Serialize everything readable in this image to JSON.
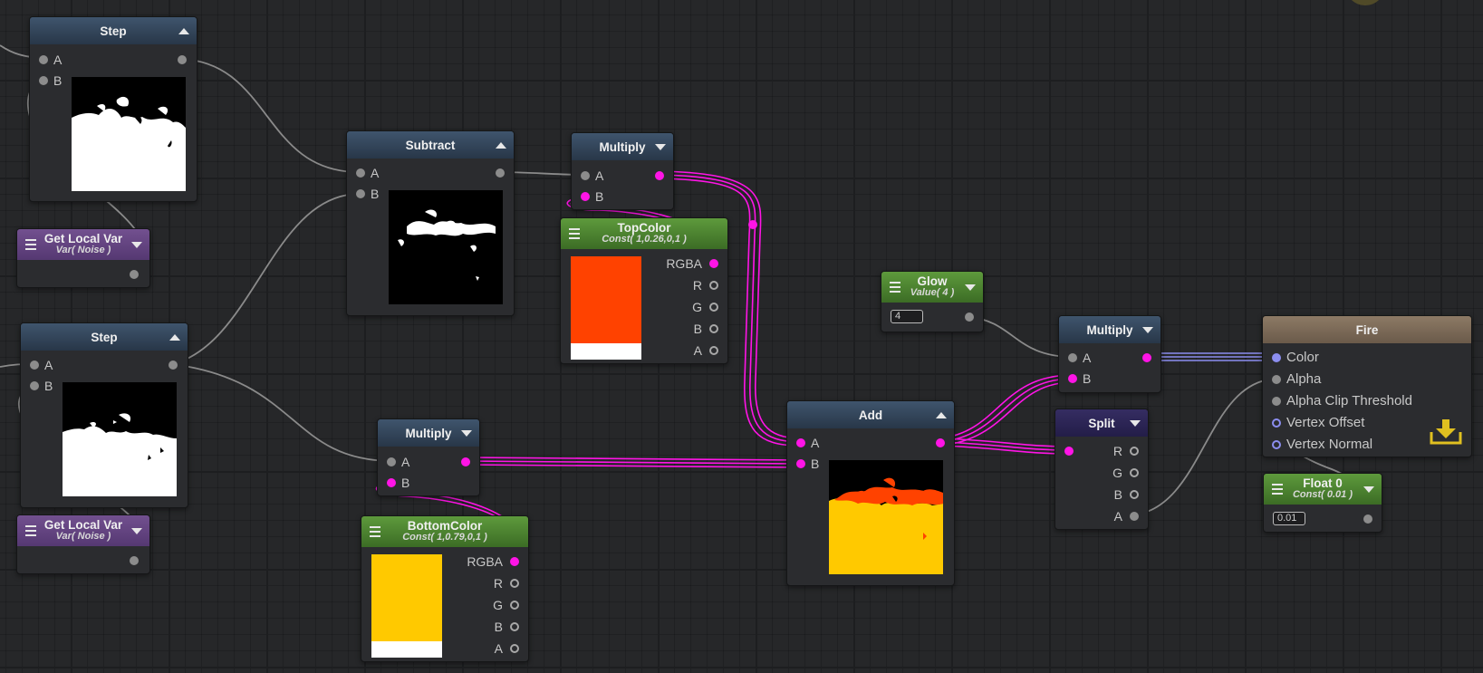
{
  "nodes": {
    "step1": {
      "title": "Step",
      "inputs": [
        "A",
        "B"
      ]
    },
    "get_local_var_1": {
      "title": "Get Local Var",
      "subtitle": "Var( Noise )"
    },
    "subtract": {
      "title": "Subtract",
      "inputs": [
        "A",
        "B"
      ]
    },
    "multiply_top": {
      "title": "Multiply",
      "inputs": [
        "A",
        "B"
      ]
    },
    "top_color": {
      "title": "TopColor",
      "subtitle": "Const( 1,0.26,0,1 )",
      "outputs": [
        "RGBA",
        "R",
        "G",
        "B",
        "A"
      ],
      "color": "#ff4200"
    },
    "step2": {
      "title": "Step",
      "inputs": [
        "A",
        "B"
      ]
    },
    "get_local_var_2": {
      "title": "Get Local Var",
      "subtitle": "Var( Noise )"
    },
    "multiply_bottom": {
      "title": "Multiply",
      "inputs": [
        "A",
        "B"
      ]
    },
    "bottom_color": {
      "title": "BottomColor",
      "subtitle": "Const( 1,0.79,0,1 )",
      "outputs": [
        "RGBA",
        "R",
        "G",
        "B",
        "A"
      ],
      "color": "#ffc900"
    },
    "glow": {
      "title": "Glow",
      "subtitle": "Value( 4 )",
      "value": "4"
    },
    "add": {
      "title": "Add",
      "inputs": [
        "A",
        "B"
      ]
    },
    "multiply_right": {
      "title": "Multiply",
      "inputs": [
        "A",
        "B"
      ]
    },
    "split": {
      "title": "Split",
      "outputs": [
        "R",
        "G",
        "B",
        "A"
      ]
    },
    "fire": {
      "title": "Fire",
      "inputs": [
        "Color",
        "Alpha",
        "Alpha Clip Threshold",
        "Vertex Offset",
        "Vertex Normal"
      ]
    },
    "float0": {
      "title": "Float 0",
      "subtitle": "Const( 0.01 )",
      "value": "0.01"
    }
  },
  "colors": {
    "wire_gray": "#909090",
    "wire_magenta": "#ff14e6",
    "wire_blue": "#8c8ef0",
    "canvas": "#262729"
  }
}
